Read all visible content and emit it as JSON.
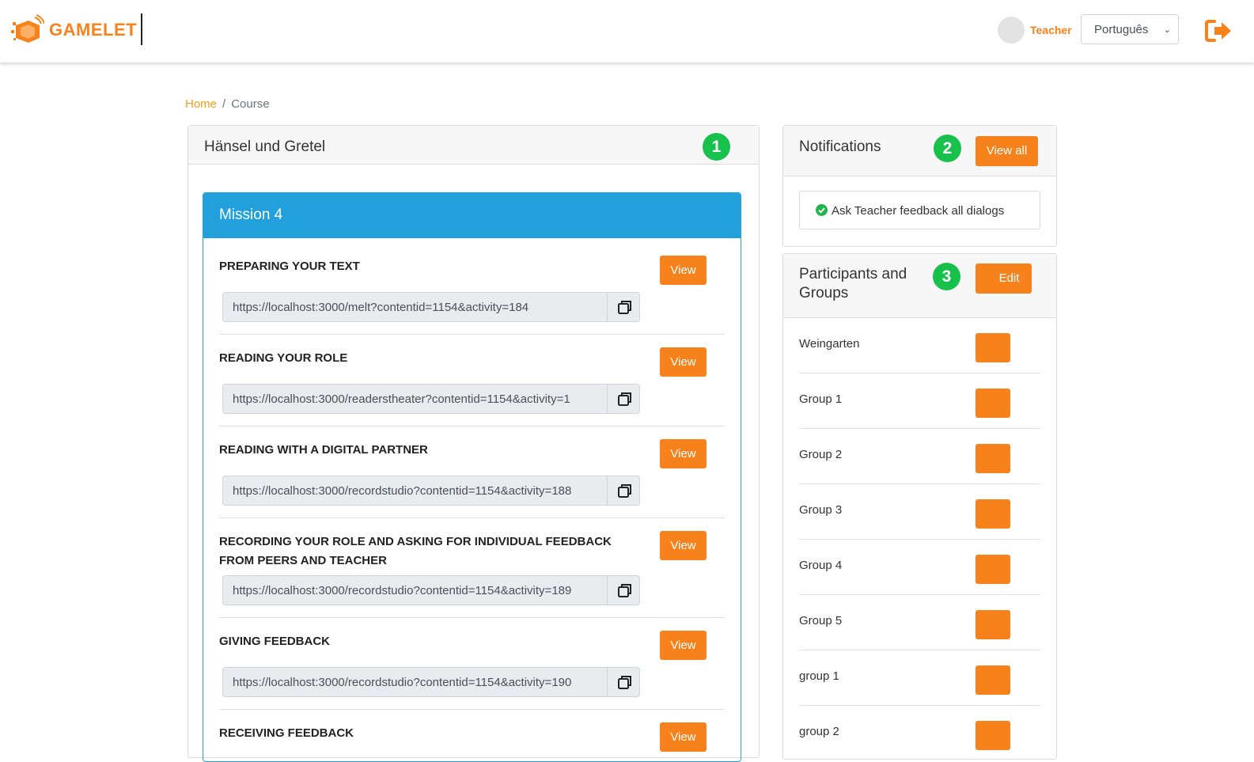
{
  "header": {
    "brand": "GAMELET",
    "username": "Teacher",
    "language": "Português",
    "accent_color": "#f7821b"
  },
  "breadcrumb": {
    "home": "Home",
    "separator": "/",
    "current": "Course"
  },
  "course": {
    "title": "Hänsel und Gretel",
    "badge": "1",
    "mission": {
      "title": "Mission 4",
      "color": "#21a0db",
      "activities": [
        {
          "title": "PREPARING YOUR TEXT",
          "url": "https://localhost:3000/melt?contentid=1154&activity=184",
          "view_label": "View"
        },
        {
          "title": "READING YOUR ROLE",
          "url": "https://localhost:3000/readerstheater?contentid=1154&activity=1",
          "view_label": "View"
        },
        {
          "title": "READING WITH A DIGITAL PARTNER",
          "url": "https://localhost:3000/recordstudio?contentid=1154&activity=188",
          "view_label": "View"
        },
        {
          "title": "RECORDING YOUR ROLE AND ASKING FOR INDIVIDUAL FEEDBACK FROM PEERS AND TEACHER",
          "url": "https://localhost:3000/recordstudio?contentid=1154&activity=189",
          "view_label": "View"
        },
        {
          "title": "GIVING FEEDBACK",
          "url": "https://localhost:3000/recordstudio?contentid=1154&activity=190",
          "view_label": "View"
        },
        {
          "title": "RECEIVING FEEDBACK",
          "url": "",
          "view_label": "View"
        }
      ]
    }
  },
  "notifications": {
    "title": "Notifications",
    "badge": "2",
    "view_all_label": "View all",
    "items": [
      {
        "text": "Ask Teacher feedback all dialogs",
        "status_icon": "check-circle-icon",
        "status_color": "#20b54c"
      }
    ]
  },
  "participants": {
    "title_line1": "Participants and",
    "title_line2": "Groups",
    "badge": "3",
    "edit_label": "Edit",
    "groups": [
      {
        "name": "Weingarten",
        "color": "#f7821b"
      },
      {
        "name": "Group 1",
        "color": "#f7821b"
      },
      {
        "name": "Group 2",
        "color": "#f7821b"
      },
      {
        "name": "Group 3",
        "color": "#f7821b"
      },
      {
        "name": "Group 4",
        "color": "#f7821b"
      },
      {
        "name": "Group 5",
        "color": "#f7821b"
      },
      {
        "name": "group 1",
        "color": "#f7821b"
      },
      {
        "name": "group 2",
        "color": "#f7821b"
      }
    ]
  }
}
